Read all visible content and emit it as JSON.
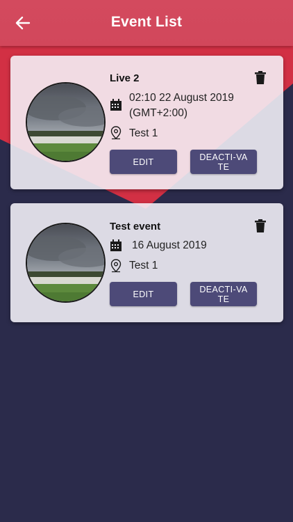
{
  "appbar": {
    "title": "Event List",
    "back_icon": "arrow-left-icon"
  },
  "colors": {
    "appbar": "#d34a5e",
    "background": "#2b2b4b",
    "accent_red": "#d23044",
    "button": "#4d4a78"
  },
  "events": [
    {
      "title": "Live 2",
      "date_line1": "02:10 22 August 2019",
      "date_line2": "(GMT+2:00)",
      "location": "Test 1",
      "edit_label": "EDIT",
      "deactivate_label": "DEACTI-VATE",
      "photo_icon": "cloudy-sky-photo"
    },
    {
      "title": "Test event",
      "date_line1": "16 August 2019",
      "location": "Test 1",
      "edit_label": "EDIT",
      "deactivate_label": "DEACTI-VATE",
      "photo_icon": "cloudy-sky-photo"
    }
  ],
  "icons": {
    "delete": "trash-icon",
    "date": "calendar-icon",
    "location": "location-pin-icon"
  }
}
